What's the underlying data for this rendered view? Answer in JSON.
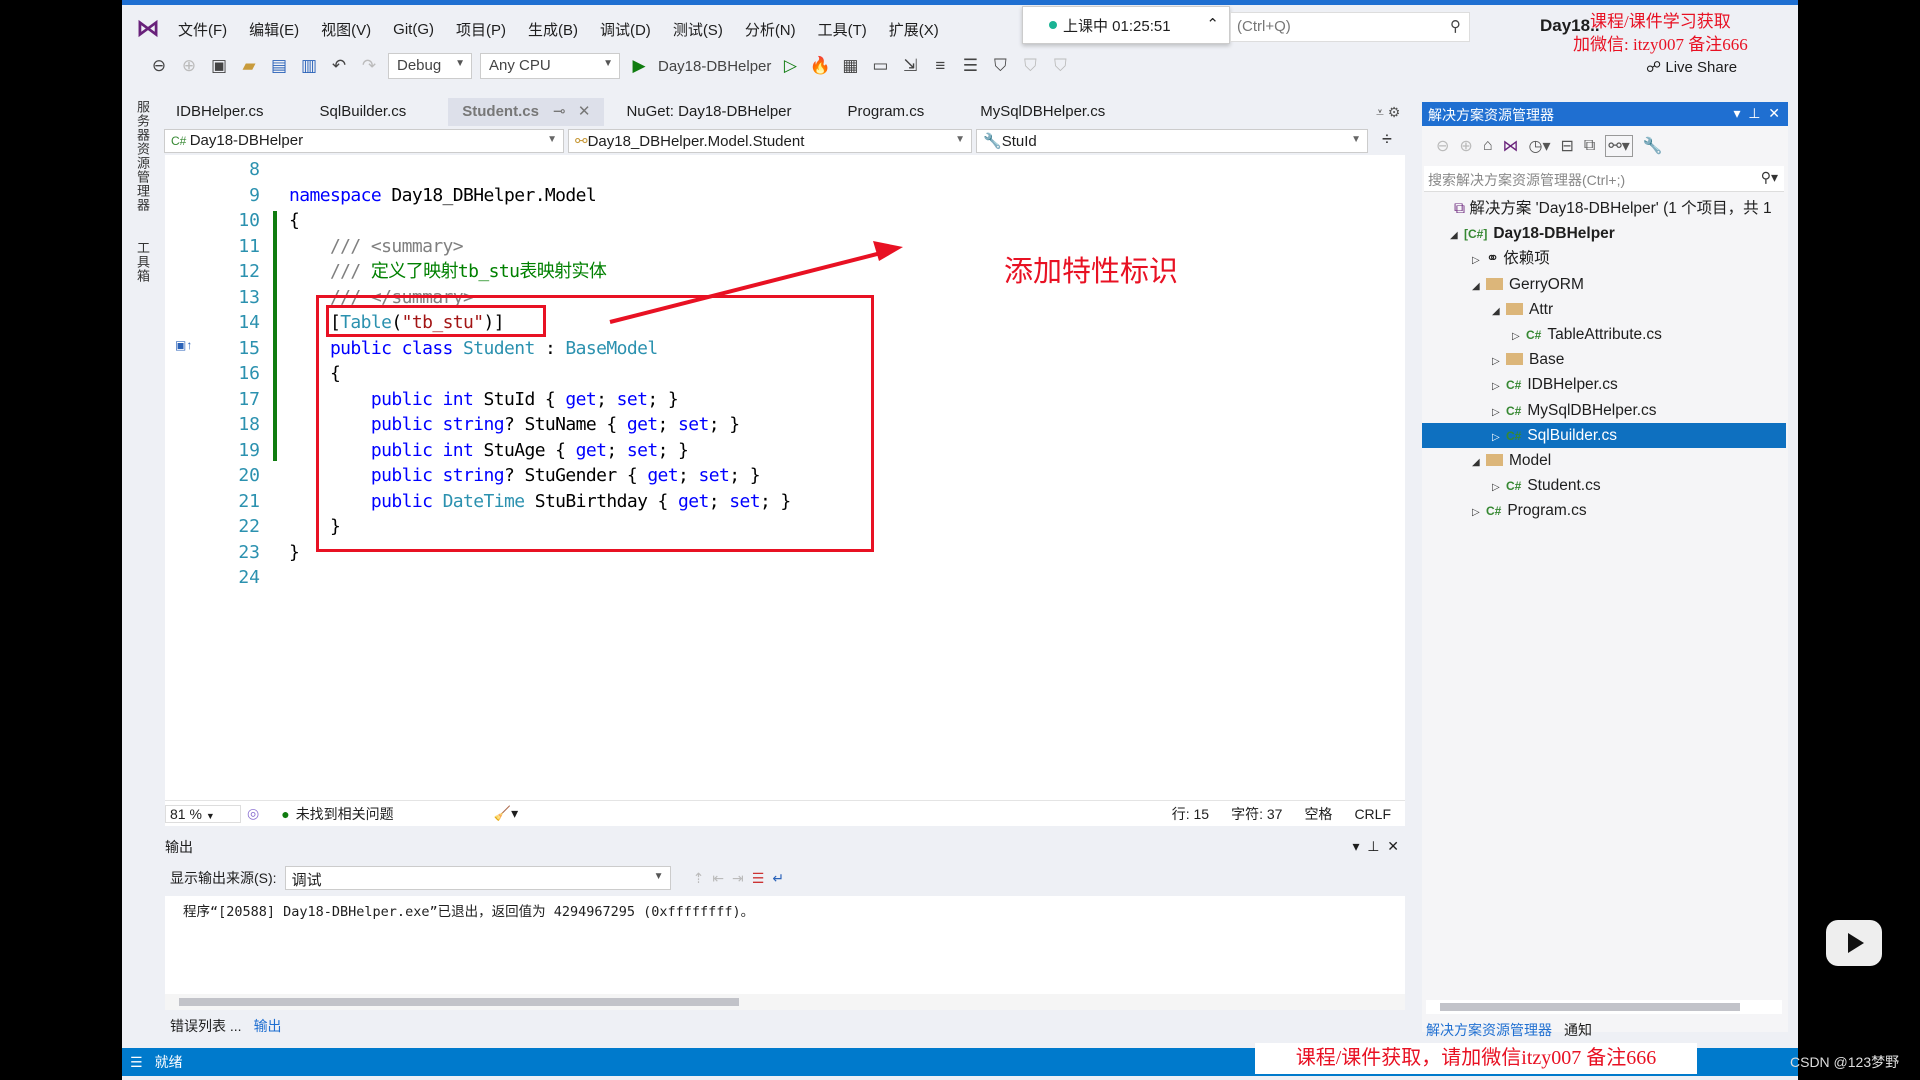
{
  "menu": {
    "items": [
      "文件(F)",
      "编辑(E)",
      "视图(V)",
      "Git(G)",
      "项目(P)",
      "生成(B)",
      "调试(D)",
      "测试(S)",
      "分析(N)",
      "工具(T)",
      "扩展(X)"
    ]
  },
  "popup": {
    "text": "上课中 01:25:51"
  },
  "quick_search": {
    "placeholder": "(Ctrl+Q)"
  },
  "window_title": "Day18..",
  "toolbar": {
    "config": "Debug",
    "platform": "Any CPU",
    "start_target": "Day18-DBHelper",
    "live_share": "Live Share"
  },
  "side_tabs": [
    "服务器资源管理器",
    "工具箱"
  ],
  "doc_tabs": [
    {
      "label": "IDBHelper.cs"
    },
    {
      "label": "SqlBuilder.cs"
    },
    {
      "label": "Student.cs",
      "active": true
    },
    {
      "label": "NuGet: Day18-DBHelper"
    },
    {
      "label": "Program.cs"
    },
    {
      "label": "MySqlDBHelper.cs"
    }
  ],
  "nav": {
    "project": "Day18-DBHelper",
    "type": "Day18_DBHelper.Model.Student",
    "member": "StuId"
  },
  "code": {
    "line_numbers": [
      "8",
      "9",
      "10",
      "11",
      "12",
      "13",
      "14",
      "15",
      "16",
      "17",
      "18",
      "19",
      "20",
      "21",
      "22",
      "23",
      "24"
    ]
  },
  "annotation": "添加特性标识",
  "editor_status": {
    "zoom": "81 %",
    "issues": "未找到相关问题",
    "line": "行: 15",
    "char": "字符: 37",
    "spaces": "空格",
    "eol": "CRLF"
  },
  "output": {
    "title": "输出",
    "source_label": "显示输出来源(S):",
    "source_value": "调试",
    "text": "程序“[20588] Day18-DBHelper.exe”已退出，返回值为 4294967295 (0xffffffff)。"
  },
  "bottom_tabs": [
    "错误列表 ...",
    "输出"
  ],
  "status": {
    "ready": "就绪"
  },
  "solution_explorer": {
    "title": "解决方案资源管理器",
    "search_placeholder": "搜索解决方案资源管理器(Ctrl+;)",
    "tree": [
      {
        "label": "解决方案 'Day18-DBHelper' (1 个项目，共 1",
        "icon": "solution-icon",
        "expander": ""
      },
      {
        "label": "Day18-DBHelper",
        "icon": "csproj-icon",
        "expander": "expanded"
      },
      {
        "label": "依赖项",
        "icon": "dependencies-icon",
        "expander": "collapsed"
      },
      {
        "label": "GerryORM",
        "icon": "folder-icon",
        "expander": "expanded"
      },
      {
        "label": "Attr",
        "icon": "folder-icon",
        "expander": "expanded"
      },
      {
        "label": "TableAttribute.cs",
        "icon": "csharp-file-icon",
        "expander": "collapsed"
      },
      {
        "label": "Base",
        "icon": "folder-icon",
        "expander": "collapsed"
      },
      {
        "label": "IDBHelper.cs",
        "icon": "csharp-file-icon",
        "expander": "collapsed"
      },
      {
        "label": "MySqlDBHelper.cs",
        "icon": "csharp-file-icon",
        "expander": "collapsed"
      },
      {
        "label": "SqlBuilder.cs",
        "icon": "csharp-file-icon",
        "expander": "collapsed",
        "selected": true
      },
      {
        "label": "Model",
        "icon": "folder-icon",
        "expander": "expanded"
      },
      {
        "label": "Student.cs",
        "icon": "csharp-file-icon",
        "expander": "collapsed"
      },
      {
        "label": "Program.cs",
        "icon": "csharp-file-icon",
        "expander": "collapsed"
      }
    ],
    "bottom_tabs": [
      "解决方案资源管理器",
      "通知"
    ]
  },
  "watermark": {
    "top_line1": "课程/课件学习获取",
    "top_line2": "加微信: itzy007 备注666",
    "bottom": "课程/课件获取，请加微信itzy007 备注666",
    "csdn": "CSDN @123梦野"
  },
  "colors": {
    "accent": "#007acc",
    "annotation": "#e81123",
    "keyword": "#0000ff",
    "type": "#2b91af"
  }
}
